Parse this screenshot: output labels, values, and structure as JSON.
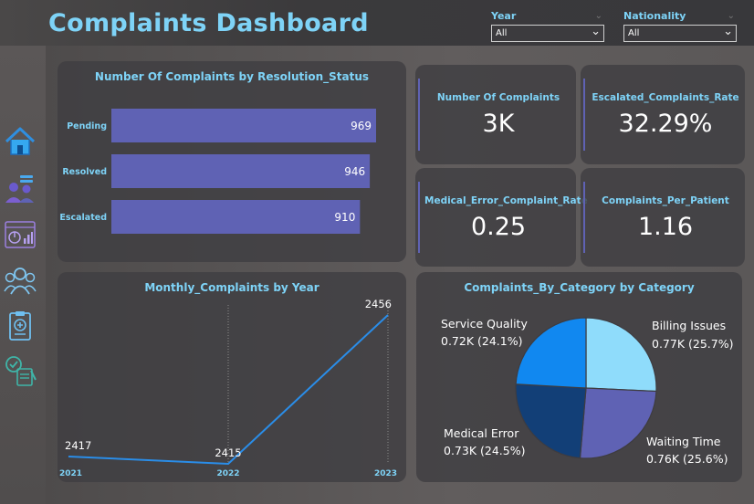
{
  "header": {
    "title": "Complaints Dashboard"
  },
  "filters": {
    "year": {
      "label": "Year",
      "value": "All"
    },
    "nationality": {
      "label": "Nationality",
      "value": "All"
    }
  },
  "nav": {
    "icons": [
      "home-icon",
      "patients-icon",
      "analytics-icon",
      "staff-icon",
      "medical-record-icon",
      "complaint-form-icon"
    ]
  },
  "kpis": {
    "number_of_complaints": {
      "label": "Number Of Complaints",
      "value": "3K"
    },
    "escalated_rate": {
      "label": "Escalated_Complaints_Rate",
      "value": "32.29%"
    },
    "medical_error_rate": {
      "label": "Medical_Error_Complaint_Rate",
      "value": "0.25"
    },
    "per_patient": {
      "label": "Complaints_Per_Patient",
      "value": "1.16"
    }
  },
  "chart_data": [
    {
      "type": "bar",
      "orientation": "horizontal",
      "title": "Number Of Complaints by Resolution_Status",
      "categories": [
        "Pending",
        "Resolved",
        "Escalated"
      ],
      "values": [
        969,
        946,
        910
      ],
      "color": "#5f62b4",
      "grid": false
    },
    {
      "type": "line",
      "title": "Monthly_Complaints by Year",
      "x": [
        "2021",
        "2022",
        "2023"
      ],
      "values": [
        2417,
        2415,
        2456
      ],
      "color": "#2a8de8",
      "grid": "vertical-dotted"
    },
    {
      "type": "pie",
      "title": "Complaints_By_Category by Category",
      "slices": [
        {
          "name": "Billing Issues",
          "value": 0.77,
          "value_label": "0.77K",
          "pct_label": "(25.7%)",
          "pct": 25.7,
          "color": "#8fdcfb"
        },
        {
          "name": "Waiting Time",
          "value": 0.76,
          "value_label": "0.76K",
          "pct_label": "(25.6%)",
          "pct": 25.6,
          "color": "#5f62b4"
        },
        {
          "name": "Medical Error",
          "value": 0.73,
          "value_label": "0.73K",
          "pct_label": "(24.5%)",
          "pct": 24.5,
          "color": "#123f77"
        },
        {
          "name": "Service Quality",
          "value": 0.72,
          "value_label": "0.72K",
          "pct_label": "(24.1%)",
          "pct": 24.1,
          "color": "#1188f0"
        }
      ]
    }
  ]
}
